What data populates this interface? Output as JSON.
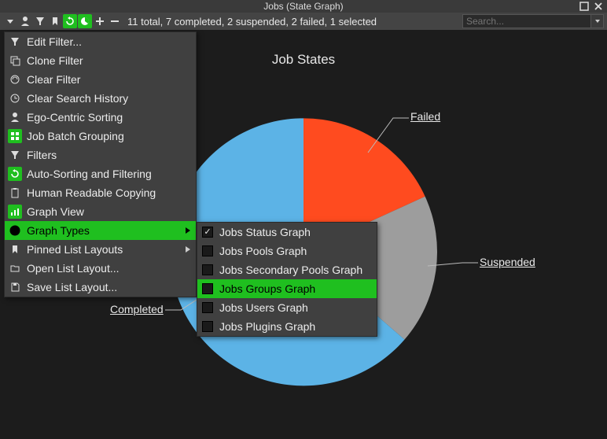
{
  "window": {
    "title": "Jobs (State Graph)"
  },
  "toolbar": {
    "status": "11 total, 7 completed, 2 suspended, 2 failed, 1 selected",
    "search_placeholder": "Search..."
  },
  "chart": {
    "title": "Job States",
    "labels": {
      "failed": "Failed",
      "suspended": "Suspended",
      "completed": "Completed"
    }
  },
  "chart_data": {
    "type": "pie",
    "title": "Job States",
    "categories": [
      "Completed",
      "Suspended",
      "Failed"
    ],
    "values": [
      7,
      2,
      2
    ],
    "colors": [
      "#5cb3e6",
      "#9d9d9d",
      "#ff4b1f"
    ],
    "total": 11
  },
  "menu": {
    "edit_filter": "Edit Filter...",
    "clone_filter": "Clone Filter",
    "clear_filter": "Clear Filter",
    "clear_search_history": "Clear Search History",
    "ego_centric_sorting": "Ego-Centric Sorting",
    "job_batch_grouping": "Job Batch Grouping",
    "filters": "Filters",
    "auto_sorting_filtering": "Auto-Sorting and Filtering",
    "human_readable_copying": "Human Readable Copying",
    "graph_view": "Graph View",
    "graph_types": "Graph Types",
    "pinned_list_layouts": "Pinned List Layouts",
    "open_list_layout": "Open List Layout...",
    "save_list_layout": "Save List Layout..."
  },
  "submenu": {
    "items": [
      {
        "label": "Jobs Status Graph",
        "checked": true
      },
      {
        "label": "Jobs Pools Graph",
        "checked": false
      },
      {
        "label": "Jobs Secondary Pools Graph",
        "checked": false
      },
      {
        "label": "Jobs Groups Graph",
        "checked": false
      },
      {
        "label": "Jobs Users Graph",
        "checked": false
      },
      {
        "label": "Jobs Plugins Graph",
        "checked": false
      }
    ],
    "highlighted_index": 3
  }
}
